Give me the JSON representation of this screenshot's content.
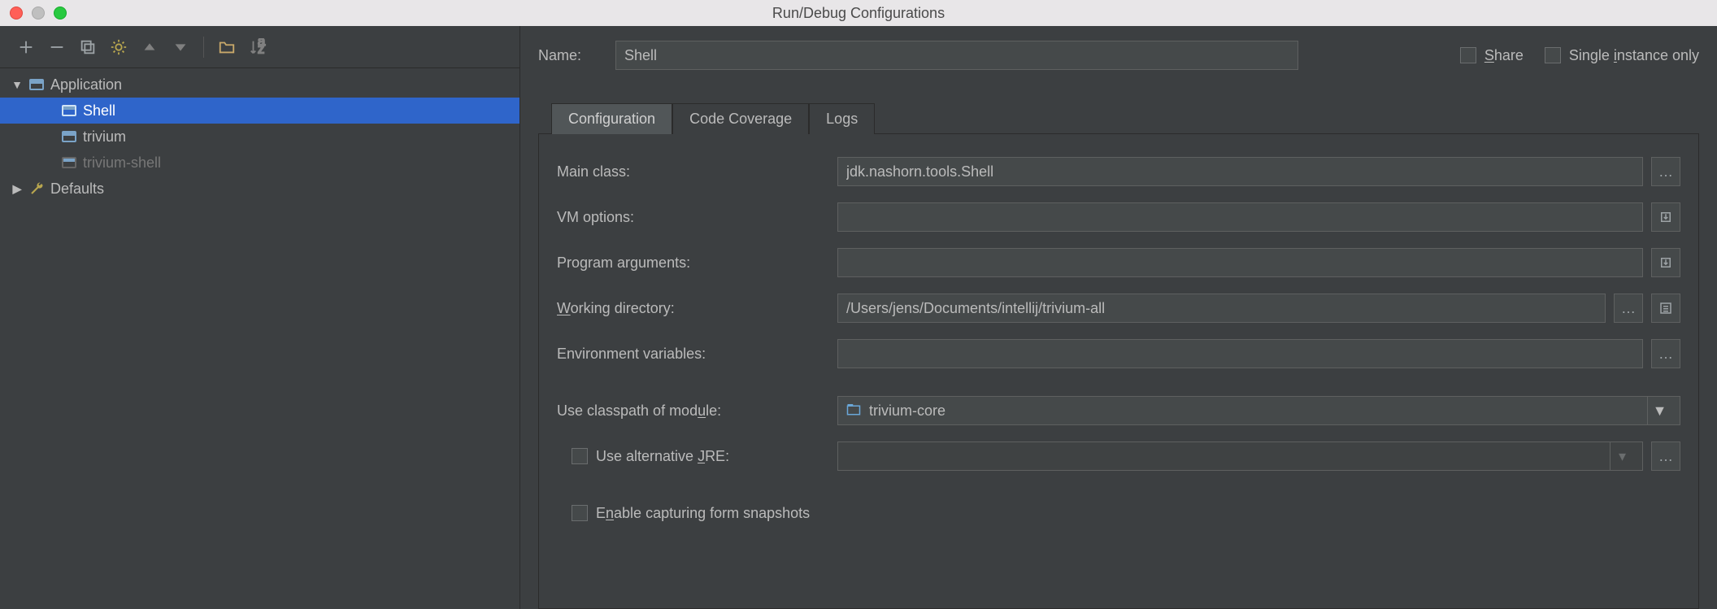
{
  "window": {
    "title": "Run/Debug Configurations"
  },
  "toolbar_icons": [
    "add",
    "remove",
    "copy",
    "wrench",
    "up",
    "down",
    "folder",
    "sort"
  ],
  "tree": {
    "root": {
      "label": "Application"
    },
    "items": [
      {
        "label": "Shell",
        "selected": true
      },
      {
        "label": "trivium",
        "selected": false
      },
      {
        "label": "trivium-shell",
        "selected": false,
        "muted": true
      }
    ],
    "defaults_label": "Defaults"
  },
  "form": {
    "name_label": "Name:",
    "name_value": "Shell",
    "share_label": "Share",
    "single_instance_label": "Single instance only",
    "tabs": [
      {
        "label": "Configuration",
        "active": true
      },
      {
        "label": "Code Coverage",
        "active": false
      },
      {
        "label": "Logs",
        "active": false
      }
    ],
    "main_class_label": "Main class:",
    "main_class_value": "jdk.nashorn.tools.Shell",
    "vm_options_label": "VM options:",
    "vm_options_value": "",
    "program_args_label": "Program arguments:",
    "program_args_value": "",
    "working_dir_label": "Working directory:",
    "working_dir_value": "/Users/jens/Documents/intellij/trivium-all",
    "env_vars_label": "Environment variables:",
    "env_vars_value": "",
    "use_classpath_label": "Use classpath of module:",
    "use_classpath_value": "trivium-core",
    "use_alt_jre_label": "Use alternative JRE:",
    "enable_form_snapshots_label": "Enable capturing form snapshots"
  }
}
